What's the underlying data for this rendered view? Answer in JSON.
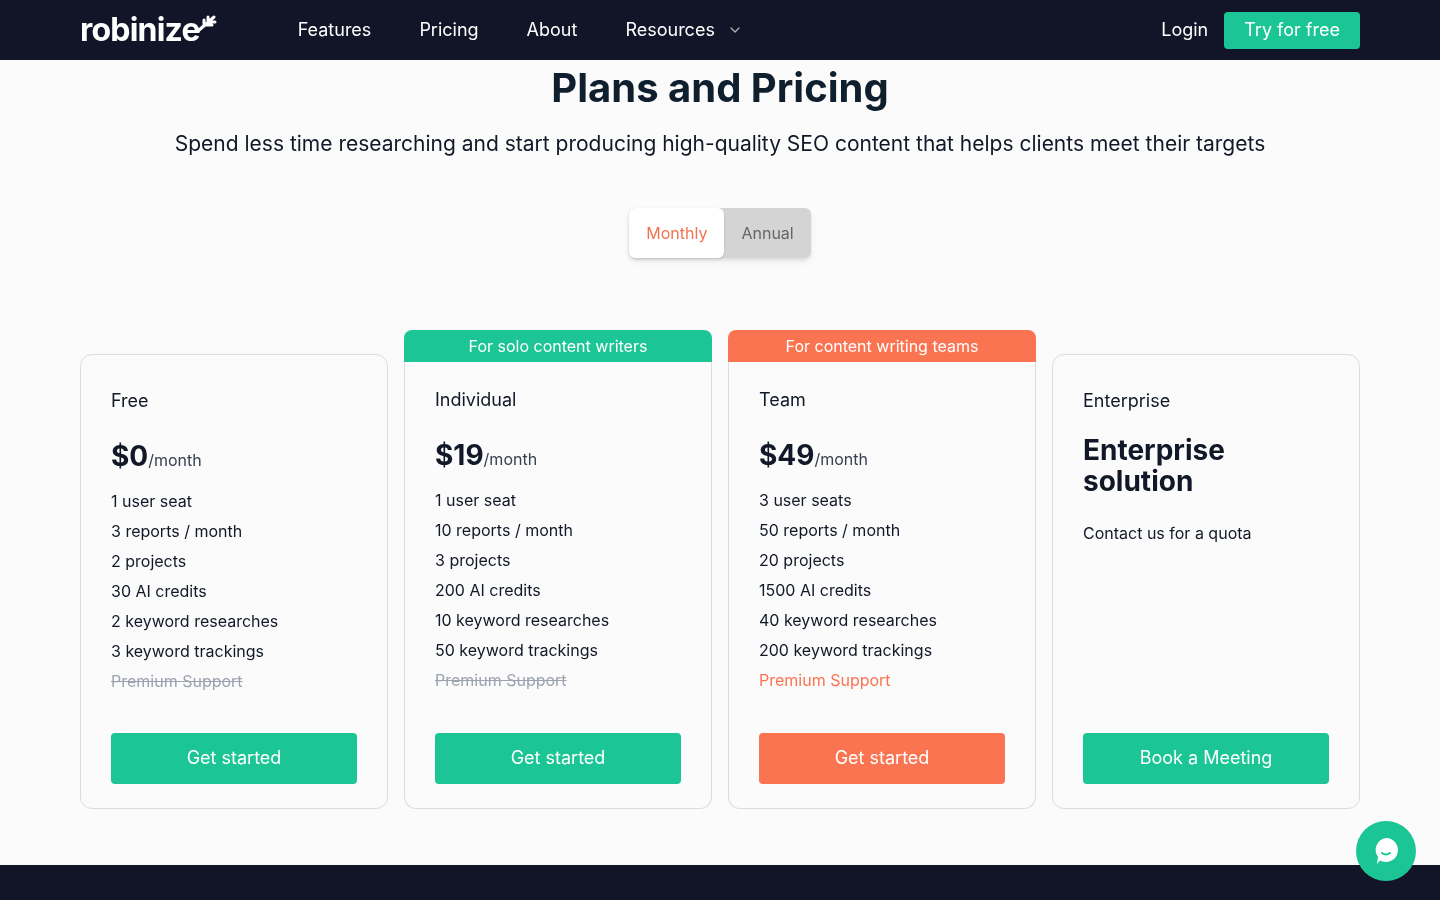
{
  "nav": {
    "logo": "robinize",
    "links": [
      {
        "label": "Features",
        "dropdown": false
      },
      {
        "label": "Pricing",
        "dropdown": false
      },
      {
        "label": "About",
        "dropdown": false
      },
      {
        "label": "Resources",
        "dropdown": true
      }
    ],
    "login": "Login",
    "cta": "Try for free"
  },
  "heading": "Plans and Pricing",
  "subtitle": "Spend less time researching and start producing high-quality SEO content that helps clients meet their targets",
  "billing": [
    {
      "label": "Monthly",
      "selected": true
    },
    {
      "label": "Annual",
      "selected": false
    }
  ],
  "plans": [
    {
      "kind": "priced",
      "name": "Free",
      "price": "$0",
      "period": "/month",
      "features": [
        {
          "text": "1 user seat",
          "included": true,
          "highlighted": false
        },
        {
          "text": "3 reports / month",
          "included": true,
          "highlighted": false
        },
        {
          "text": "2 projects",
          "included": true,
          "highlighted": false
        },
        {
          "text": "30 AI credits",
          "included": true,
          "highlighted": false
        },
        {
          "text": "2 keyword researches",
          "included": true,
          "highlighted": false
        },
        {
          "text": "3 keyword trackings",
          "included": true,
          "highlighted": false
        },
        {
          "text": "Premium Support",
          "included": false,
          "highlighted": false
        }
      ],
      "button": "Get started",
      "color": "#1cc595"
    },
    {
      "kind": "priced",
      "name": "Individual",
      "ribbon": "For solo content writers",
      "price": "$19",
      "period": "/month",
      "features": [
        {
          "text": "1 user seat",
          "included": true,
          "highlighted": false
        },
        {
          "text": "10 reports / month",
          "included": true,
          "highlighted": false
        },
        {
          "text": "3 projects",
          "included": true,
          "highlighted": false
        },
        {
          "text": "200 AI credits",
          "included": true,
          "highlighted": false
        },
        {
          "text": "10 keyword researches",
          "included": true,
          "highlighted": false
        },
        {
          "text": "50 keyword trackings",
          "included": true,
          "highlighted": false
        },
        {
          "text": "Premium Support",
          "included": false,
          "highlighted": false
        }
      ],
      "button": "Get started",
      "color": "#1cc595"
    },
    {
      "kind": "priced",
      "name": "Team",
      "ribbon": "For content writing teams",
      "price": "$49",
      "period": "/month",
      "features": [
        {
          "text": "3 user seats",
          "included": true,
          "highlighted": false
        },
        {
          "text": "50 reports / month",
          "included": true,
          "highlighted": false
        },
        {
          "text": "20 projects",
          "included": true,
          "highlighted": false
        },
        {
          "text": "1500 AI credits",
          "included": true,
          "highlighted": false
        },
        {
          "text": "40 keyword researches",
          "included": true,
          "highlighted": false
        },
        {
          "text": "200 keyword trackings",
          "included": true,
          "highlighted": false
        },
        {
          "text": "Premium Support",
          "included": true,
          "highlighted": true
        }
      ],
      "button": "Get started",
      "color": "#fa7452"
    },
    {
      "kind": "custom",
      "name": "Enterprise",
      "price": "Enterprise solution",
      "note": "Contact us for a quota",
      "button": "Book a Meeting",
      "color": "#1cc595"
    }
  ]
}
